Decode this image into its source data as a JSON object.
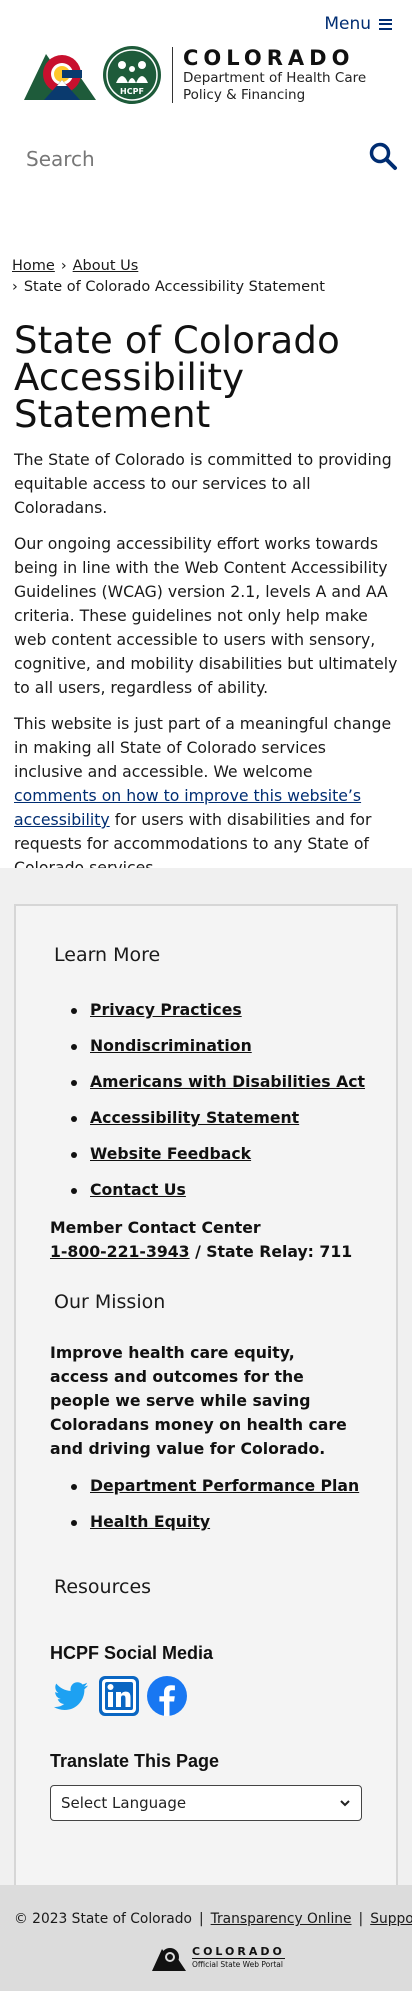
{
  "header": {
    "menu_label": "Menu",
    "logo_colorado": "COLORADO",
    "logo_dept_line1": "Department of Health Care",
    "logo_dept_line2": "Policy & Financing",
    "hcpf_badge": "HCPF"
  },
  "search": {
    "placeholder": "Search"
  },
  "breadcrumb": {
    "home": "Home",
    "about": "About Us",
    "current": "State of Colorado Accessibility Statement"
  },
  "main": {
    "title": "State of Colorado Accessibility Statement",
    "p1": "The State of Colorado is committed to providing equitable access to our services to all Coloradans.",
    "p2": "Our ongoing accessibility effort works towards being in line with the Web Content Accessibility Guidelines (WCAG) version 2.1, levels A and AA criteria. These guidelines not only help make web content accessible to users with sensory, cognitive, and mobility disabilities but ultimately to all users, regardless of ability.",
    "p3_before": "This website is just part of a meaningful change in making all State of Colorado services inclusive and accessible. We welcome ",
    "p3_link": "comments on how to improve this website’s accessibility",
    "p3_after": " for users with disabilities and for requests for accommodations to any State of Colorado services."
  },
  "footer": {
    "learn_more_heading": "Learn More",
    "learn_more_links": [
      "Privacy Practices",
      "Nondiscrimination",
      "Americans with Disabilities Act",
      "Accessibility Statement",
      "Website Feedback",
      "Contact Us"
    ],
    "contact_label": "Member Contact Center",
    "contact_phone": "1-800-221-3943",
    "contact_relay": " / State Relay: 711",
    "mission_heading": "Our Mission",
    "mission_text": "Improve health care equity, access and outcomes for the people we serve while saving Coloradans money on health care and driving value for Colorado.",
    "mission_links": [
      "Department Performance Plan",
      "Health Equity"
    ],
    "resources_heading": "Resources",
    "social_heading": "HCPF Social Media",
    "social_icons": [
      "twitter-icon",
      "linkedin-icon",
      "facebook-icon"
    ],
    "translate_heading": "Translate This Page",
    "language_select": "Select Language"
  },
  "bottom": {
    "copyright": "© 2023 State of Colorado",
    "transparency": "Transparency Online",
    "support": "Support",
    "portal_colorado": "COLORADO",
    "portal_sub": "Official State Web Portal"
  },
  "colors": {
    "link_blue": "#002d72",
    "footer_bg": "#f0f0f0",
    "bottom_bar": "#dcdcdc",
    "logo_red": "#c8102e",
    "logo_green": "#1e5b3a",
    "logo_yellow": "#ffc72c",
    "logo_blue": "#0a3a6e"
  }
}
